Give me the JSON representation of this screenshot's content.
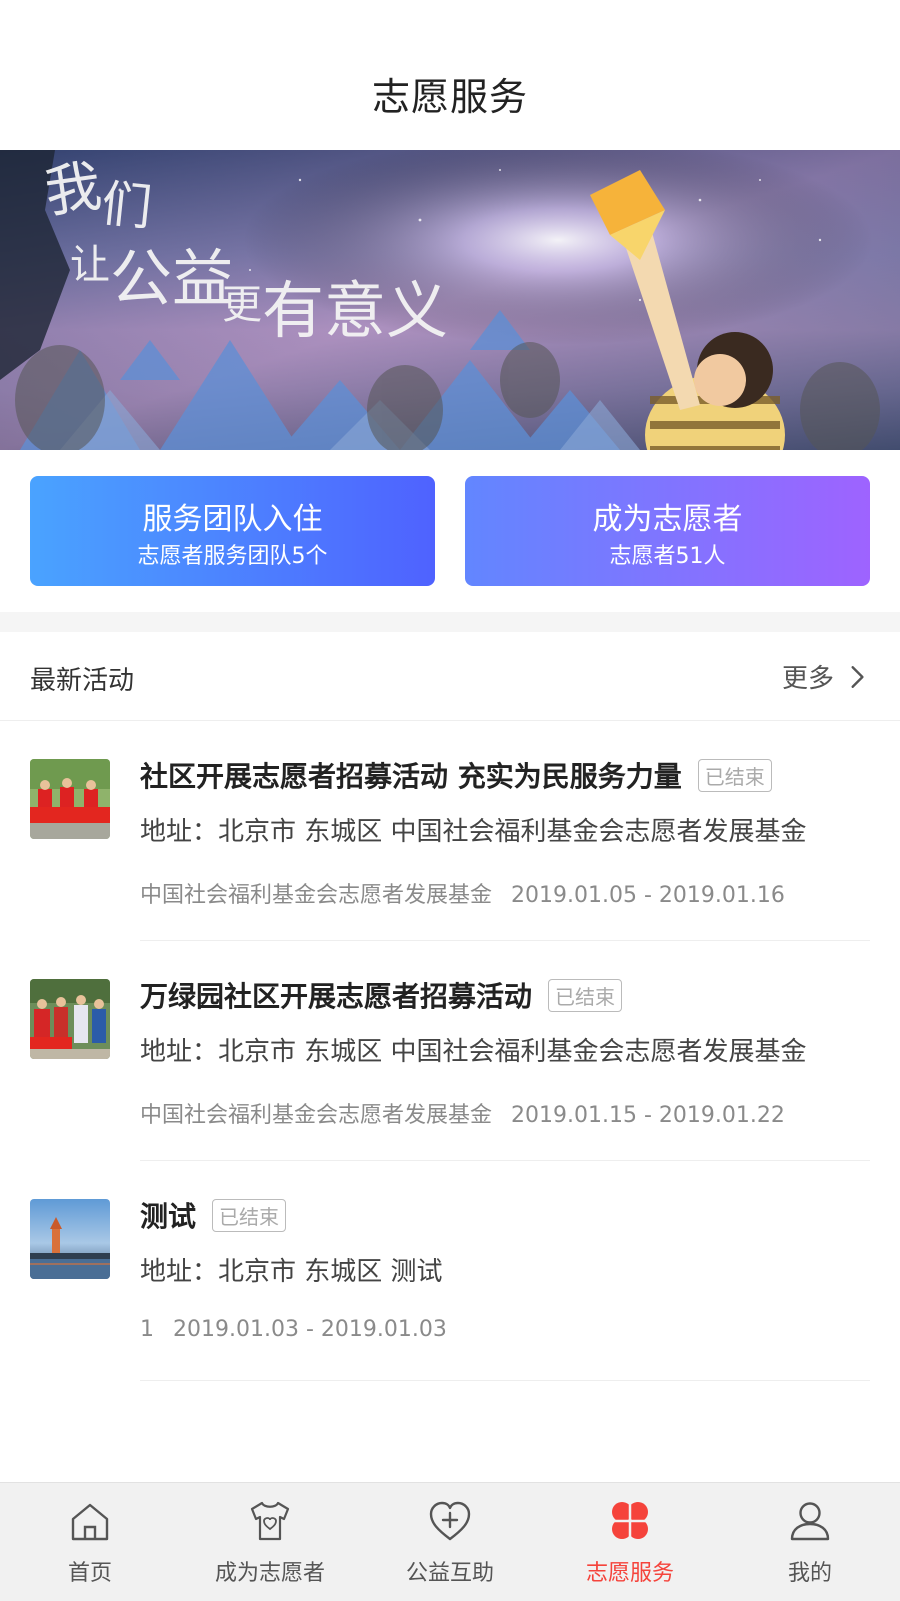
{
  "header": {
    "title": "志愿服务"
  },
  "banner": {
    "headline": [
      "我们",
      "让公益更有意义"
    ]
  },
  "actions": [
    {
      "title": "服务团队入住",
      "subtitle": "志愿者服务团队5个"
    },
    {
      "title": "成为志愿者",
      "subtitle": "志愿者51人"
    }
  ],
  "section": {
    "title": "最新活动",
    "more_label": "更多"
  },
  "activities": [
    {
      "title": "社区开展志愿者招募活动 充实为民服务力量",
      "status": "已结束",
      "address": "地址：北京市 东城区 中国社会福利基金会志愿者发展基金",
      "organizer": "中国社会福利基金会志愿者发展基金",
      "dates": "2019.01.05 - 2019.01.16"
    },
    {
      "title": "万绿园社区开展志愿者招募活动",
      "status": "已结束",
      "address": "地址：北京市 东城区 中国社会福利基金会志愿者发展基金",
      "organizer": "中国社会福利基金会志愿者发展基金",
      "dates": "2019.01.15 - 2019.01.22"
    },
    {
      "title": "测试",
      "status": "已结束",
      "address": "地址：北京市 东城区 测试",
      "organizer": "1",
      "dates": "2019.01.03 - 2019.01.03"
    }
  ],
  "tabbar": {
    "items": [
      {
        "label": "首页",
        "icon": "home-icon"
      },
      {
        "label": "成为志愿者",
        "icon": "shirt-icon"
      },
      {
        "label": "公益互助",
        "icon": "heart-plus-icon"
      },
      {
        "label": "志愿服务",
        "icon": "clover-icon",
        "active": true
      },
      {
        "label": "我的",
        "icon": "user-icon"
      }
    ]
  },
  "colors": {
    "accent": "#f5433b",
    "card_left": "#4f62ff",
    "card_right": "#9e63ff"
  }
}
